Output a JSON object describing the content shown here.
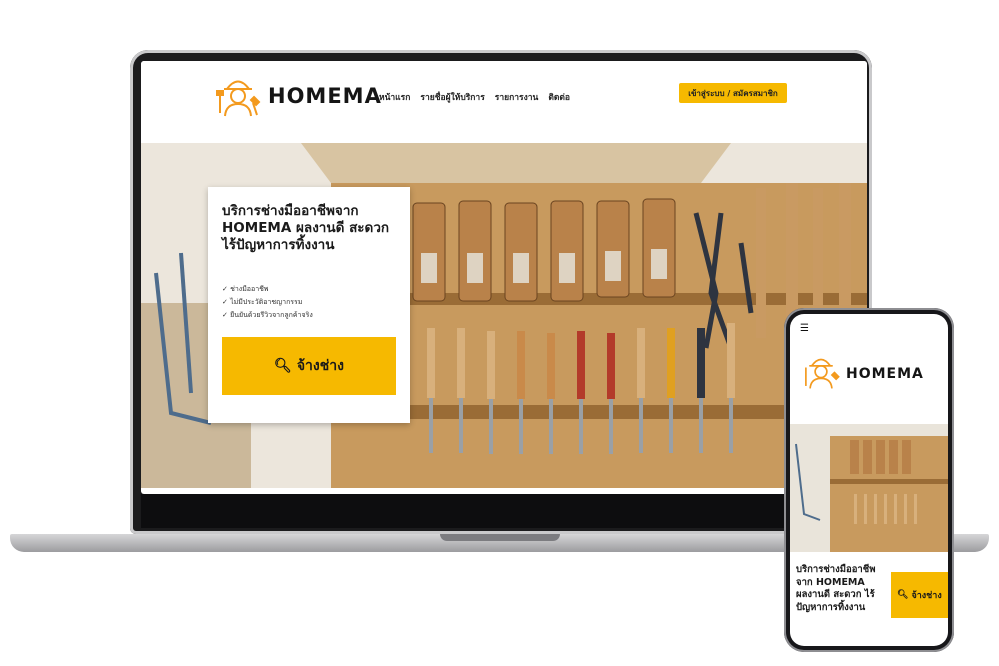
{
  "brand": {
    "name": "HOMEMA",
    "accent_color": "#f6b900",
    "logo_icon": "handyman-logo-icon"
  },
  "nav": {
    "items": [
      "หน้าแรก",
      "รายชื่อผู้ให้บริการ",
      "รายการงาน",
      "ติดต่อ"
    ]
  },
  "header": {
    "login_label": "เข้าสู่ระบบ / สมัครสมาชิก"
  },
  "hero": {
    "title": "บริการช่างมืออาชีพจาก HOMEMA ผลงานดี สะดวก ไร้ปัญหาการทิ้งงาน",
    "features": [
      "ช่างมืออาชีพ",
      "ไม่มีประวัติอาชญากรรม",
      "ยืนยันด้วยรีวิวจากลูกค้าจริง"
    ],
    "cta_label": "จ้างช่าง",
    "cta_icon": "search-icon"
  },
  "mobile": {
    "menu_icon": "hamburger-menu-icon",
    "title": "บริการช่างมืออาชีพจาก HOMEMA ผลงานดี สะดวก ไร้ปัญหาการทิ้งงาน",
    "cta_label": "จ้างช่าง"
  }
}
